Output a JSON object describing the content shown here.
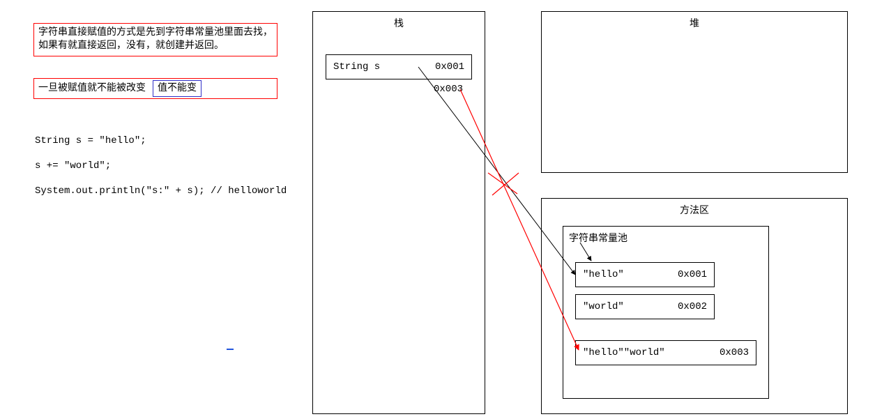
{
  "notes": {
    "box1": "字符串直接赋值的方式是先到字符串常量池里面去找，如果有就直接返回，没有，就创建并返回。",
    "box2_text": "一旦被赋值就不能被改变",
    "box2_badge": "值不能变"
  },
  "code": {
    "line1": "String s = \"hello\";",
    "line2": "s += \"world\";",
    "line3": "System.out.println(\"s:\" + s); // helloworld"
  },
  "stack": {
    "title": "栈",
    "var_name": "String s",
    "addr_current": "0x001",
    "addr_new": "0x003"
  },
  "heap": {
    "title": "堆"
  },
  "method_area": {
    "title": "方法区",
    "pool_title": "字符串常量池",
    "entries": [
      {
        "value": "\"hello\"",
        "addr": "0x001"
      },
      {
        "value": "\"world\"",
        "addr": "0x002"
      },
      {
        "value": "\"hello\"\"world\"",
        "addr": "0x003"
      }
    ]
  }
}
